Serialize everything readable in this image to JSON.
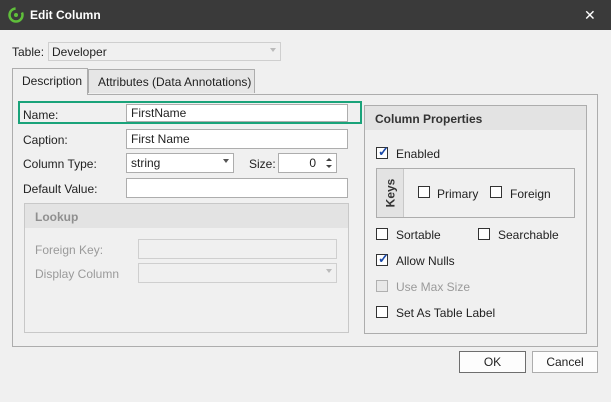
{
  "window": {
    "title": "Edit Column",
    "icon": "app-logo-icon",
    "close_glyph": "✕"
  },
  "table_selector": {
    "label": "Table:",
    "value": "Developer"
  },
  "tabs": [
    {
      "label": "Description",
      "active": true
    },
    {
      "label": "Attributes (Data Annotations)",
      "active": false
    }
  ],
  "fields": {
    "name": {
      "label": "Name:",
      "value": "FirstName"
    },
    "caption": {
      "label": "Caption:",
      "value": "First Name"
    },
    "column_type": {
      "label": "Column Type:",
      "value": "string"
    },
    "size": {
      "label": "Size:",
      "value": "0"
    },
    "default_value": {
      "label": "Default Value:",
      "value": ""
    }
  },
  "lookup": {
    "title": "Lookup",
    "foreign_key": {
      "label": "Foreign Key:",
      "value": ""
    },
    "display_column": {
      "label": "Display Column",
      "value": ""
    }
  },
  "column_properties": {
    "title": "Column Properties",
    "enabled": {
      "label": "Enabled",
      "checked": true
    },
    "keys": {
      "title": "Keys",
      "primary": {
        "label": "Primary",
        "checked": false
      },
      "foreign": {
        "label": "Foreign",
        "checked": false
      }
    },
    "sortable": {
      "label": "Sortable",
      "checked": false
    },
    "searchable": {
      "label": "Searchable",
      "checked": false
    },
    "allow_nulls": {
      "label": "Allow Nulls",
      "checked": true
    },
    "use_max_size": {
      "label": "Use Max Size",
      "checked": false,
      "disabled": true
    },
    "set_as_table_label": {
      "label": "Set As Table Label",
      "checked": false
    }
  },
  "buttons": {
    "ok": "OK",
    "cancel": "Cancel"
  },
  "colors": {
    "titlebar": "#3a3a3a",
    "highlight": "#1aa37a",
    "check": "#1b4aa8"
  }
}
